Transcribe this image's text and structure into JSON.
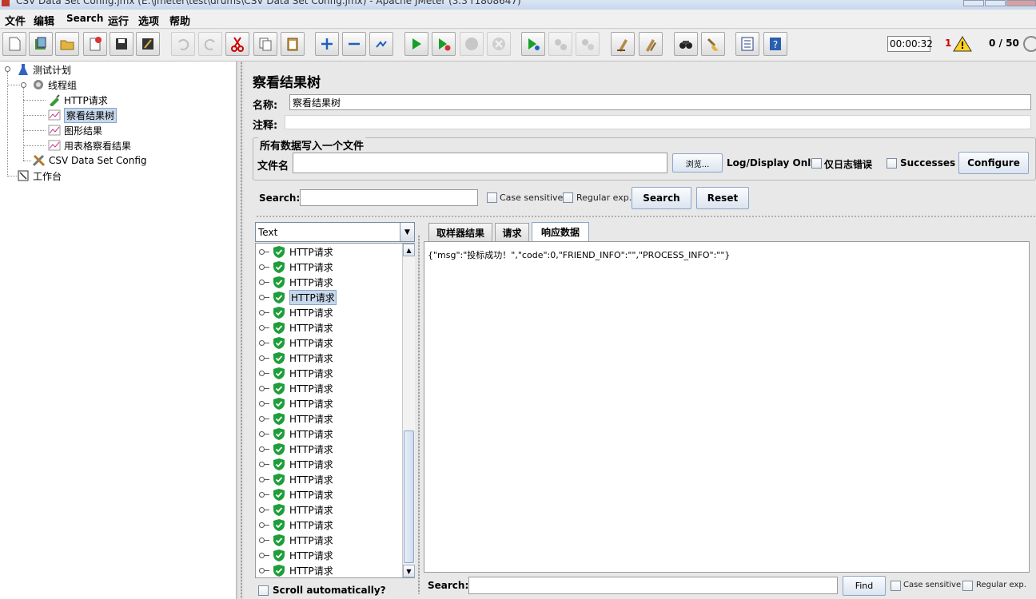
{
  "window": {
    "title": "CSV Data Set Config.jmx (E:\\jmeter\\test\\drums\\CSV Data Set Config.jmx) - Apache JMeter (3.3 r1808647)"
  },
  "menu": [
    "文件",
    "编辑",
    "Search",
    "运行",
    "选项",
    "帮助"
  ],
  "toolbar": {
    "buttons": [
      "new-icon",
      "templates-icon",
      "open-icon",
      "close-icon",
      "save-icon",
      "save-as-icon",
      "undo-icon",
      "redo-icon",
      "cut-icon",
      "copy-icon",
      "paste-icon",
      "expand-icon",
      "collapse-icon",
      "toggle-icon",
      "start-icon",
      "start-no-pause-icon",
      "stop-icon",
      "shutdown-icon",
      "remote-start-icon",
      "remote-stop-icon",
      "remote-exit-icon",
      "clear-icon",
      "clear-all-icon",
      "search-icon",
      "reset-search-icon",
      "function-helper-icon",
      "help-icon"
    ],
    "timer": "00:00:32",
    "error_count": "1",
    "threads": "0 / 50"
  },
  "tree": {
    "items": [
      {
        "label": "测试计划",
        "icon": "test-plan-icon"
      },
      {
        "label": "线程组",
        "icon": "thread-group-icon"
      },
      {
        "label": "HTTP请求",
        "icon": "http-sampler-icon"
      },
      {
        "label": "察看结果树",
        "icon": "listener-icon",
        "selected": true
      },
      {
        "label": "图形结果",
        "icon": "listener-icon"
      },
      {
        "label": "用表格察看结果",
        "icon": "listener-icon"
      },
      {
        "label": "CSV Data Set Config",
        "icon": "config-element-icon"
      },
      {
        "label": "工作台",
        "icon": "workbench-icon"
      }
    ]
  },
  "panel": {
    "title": "察看结果树",
    "name_label": "名称:",
    "name_value": "察看结果树",
    "comment_label": "注释:",
    "comment_value": "",
    "file_group_title": "所有数据写入一个文件",
    "filename_label": "文件名",
    "filename_value": "",
    "browse_label": "浏览...",
    "log_display_label": "Log/Display Only:",
    "errors_only_label": "仅日志错误",
    "successes_label": "Successes",
    "configure_label": "Configure"
  },
  "search": {
    "label": "Search:",
    "value": "",
    "case_sensitive": "Case sensitive",
    "regex": "Regular exp.",
    "search_button": "Search",
    "reset_button": "Reset"
  },
  "results": {
    "renderer": "Text",
    "items": [
      "HTTP请求",
      "HTTP请求",
      "HTTP请求",
      "HTTP请求",
      "HTTP请求",
      "HTTP请求",
      "HTTP请求",
      "HTTP请求",
      "HTTP请求",
      "HTTP请求",
      "HTTP请求",
      "HTTP请求",
      "HTTP请求",
      "HTTP请求",
      "HTTP请求",
      "HTTP请求",
      "HTTP请求",
      "HTTP请求",
      "HTTP请求",
      "HTTP请求",
      "HTTP请求",
      "HTTP请求"
    ],
    "selected_index": 3,
    "scroll_auto": "Scroll automatically?"
  },
  "tabs": [
    "取样器结果",
    "请求",
    "响应数据"
  ],
  "active_tab": 2,
  "response": {
    "text": "{\"msg\":\"投标成功！\",\"code\":0,\"FRIEND_INFO\":\"\",\"PROCESS_INFO\":\"\"}"
  },
  "bottom_search": {
    "label": "Search:",
    "value": "",
    "find": "Find",
    "case_sensitive": "Case sensitive",
    "regex": "Regular exp."
  }
}
